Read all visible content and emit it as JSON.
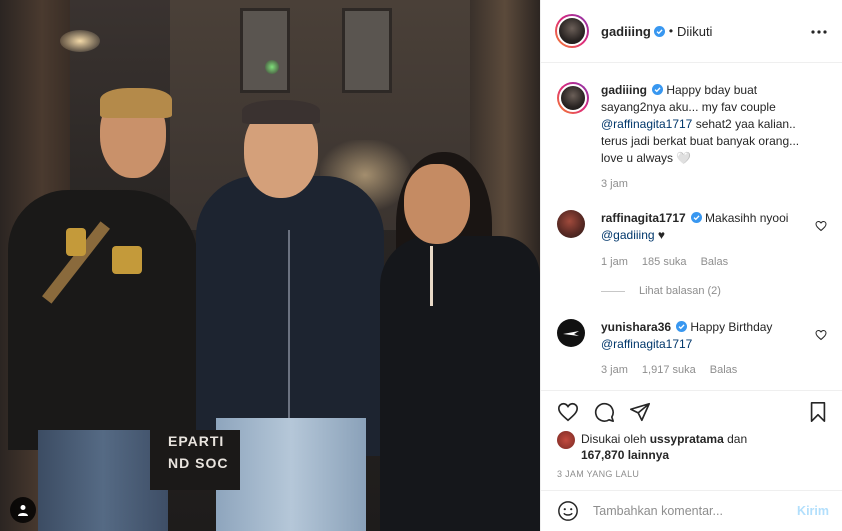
{
  "post": {
    "username": "gadiiing",
    "follow_status": "Diikuti",
    "more_icon": "more-horizontal-icon",
    "photo": {
      "sign_lines": [
        "EPARTI",
        "ND SOC"
      ]
    }
  },
  "comments": [
    {
      "username": "gadiiing",
      "text_before": "Happy bday buat sayang2nya aku... my fav couple",
      "mention": "@raffinagita1717",
      "text_after": "sehat2 yaa kalian.. terus jadi berkat buat banyak orang... love u always 🤍",
      "time": "3 jam",
      "verified": true
    },
    {
      "username": "raffinagita1717",
      "text_before": "Makasihh nyooi",
      "mention": "@gadiiing",
      "text_after": "♥",
      "time": "1 jam",
      "likes": "185 suka",
      "reply": "Balas",
      "view_replies": "Lihat balasan (2)",
      "verified": true
    },
    {
      "username": "yunishara36",
      "text_before": "Happy Birthday",
      "mention": "@raffinagita1717",
      "text_after": "",
      "time": "3 jam",
      "likes": "1,917 suka",
      "reply": "Balas",
      "verified": true
    }
  ],
  "likes_section": {
    "prefix": "Disukai oleh",
    "liker": "ussypratama",
    "conj": "dan",
    "count": "167,870 lainnya"
  },
  "timestamp": "3 JAM YANG LALU",
  "comment_box": {
    "placeholder": "Tambahkan komentar...",
    "post_label": "Kirim"
  },
  "colors": {
    "link": "#00376b",
    "verified": "#3897f0",
    "muted": "#8e8e8e",
    "post_disabled": "#b2dffc"
  }
}
